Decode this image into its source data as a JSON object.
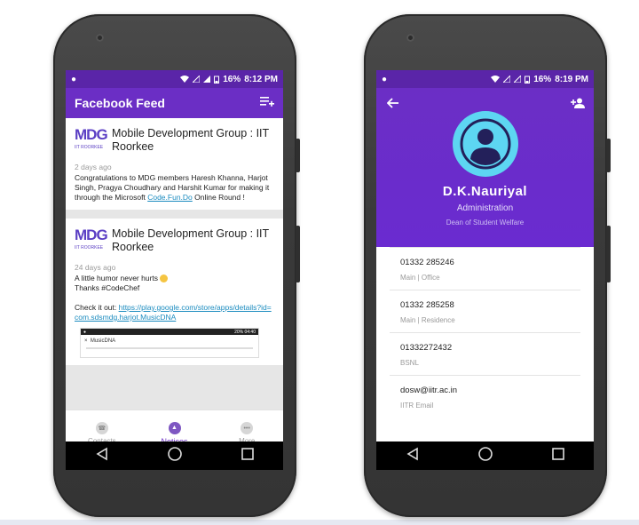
{
  "status_left": {
    "battery": "16%",
    "time": "8:12 PM"
  },
  "status_right": {
    "battery": "16%",
    "time": "8:19 PM"
  },
  "feed_screen": {
    "title": "Facebook Feed",
    "posts": [
      {
        "logo_mark": "MDG",
        "logo_sub": "IIT ROORKEE",
        "author": "Mobile Development Group : IIT Roorkee",
        "time_ago": "2 days ago",
        "text": "Congratulations to MDG members Haresh Khanna, Harjot Singh, Pragya Choudhary and Harshit Kumar for making it through the Microsoft ",
        "link": "Code.Fun.Do",
        "text_after": " Online Round !"
      },
      {
        "logo_mark": "MDG",
        "logo_sub": "IIT ROORKEE",
        "author": "Mobile Development Group : IIT Roorkee",
        "time_ago": "24 days ago",
        "text_line1": "A little humor never hurts",
        "text_line2": "Thanks #CodeChef",
        "check_text": "Check it out: ",
        "link": "https://play.google.com/store/apps/details?id=com.sdsmdg.harjot.MusicDNA",
        "thumb_status": "20% 04:40",
        "thumb_label": "MusicDNA"
      }
    ],
    "bottom_nav": [
      {
        "label": "Contacts",
        "icon": "contacts-icon"
      },
      {
        "label": "Notices",
        "icon": "bell-icon"
      },
      {
        "label": "More",
        "icon": "more-icon"
      }
    ],
    "active_tab": "Notices"
  },
  "profile_screen": {
    "name": "D.K.Nauriyal",
    "department": "Administration",
    "designation": "Dean of Student  Welfare",
    "contacts": [
      {
        "value": "01332 285246",
        "label": "Main | Office"
      },
      {
        "value": "01332 285258",
        "label": "Main | Residence"
      },
      {
        "value": "01332272432",
        "label": "BSNL"
      },
      {
        "value": "dosw@iitr.ac.in",
        "label": "IITR Email"
      }
    ]
  },
  "colors": {
    "primary": "#6b2ec5",
    "avatar_bg": "#5dd6f2",
    "link": "#1a8bbf"
  }
}
